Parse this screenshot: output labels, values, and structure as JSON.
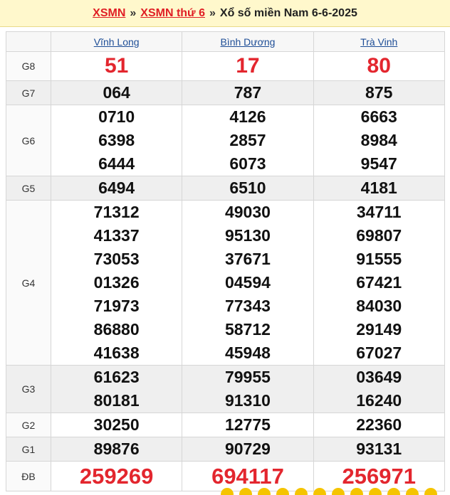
{
  "header": {
    "link1": "XSMN",
    "sep1": "»",
    "link2": "XSMN thứ 6",
    "sep2": "»",
    "title": "Xổ số miền Nam 6-6-2025"
  },
  "provinces": [
    "Vĩnh Long",
    "Bình Dương",
    "Trà Vinh"
  ],
  "prizes": {
    "g8": {
      "label": "G8",
      "values": [
        "51",
        "17",
        "80"
      ]
    },
    "g7": {
      "label": "G7",
      "values": [
        "064",
        "787",
        "875"
      ]
    },
    "g6": {
      "label": "G6",
      "values": [
        [
          "0710",
          "6398",
          "6444"
        ],
        [
          "4126",
          "2857",
          "6073"
        ],
        [
          "6663",
          "8984",
          "9547"
        ]
      ]
    },
    "g5": {
      "label": "G5",
      "values": [
        "6494",
        "6510",
        "4181"
      ]
    },
    "g4": {
      "label": "G4",
      "values": [
        [
          "71312",
          "41337",
          "73053",
          "01326",
          "71973",
          "86880",
          "41638"
        ],
        [
          "49030",
          "95130",
          "37671",
          "04594",
          "77343",
          "58712",
          "45948"
        ],
        [
          "34711",
          "69807",
          "91555",
          "67421",
          "84030",
          "29149",
          "67027"
        ]
      ]
    },
    "g3": {
      "label": "G3",
      "values": [
        [
          "61623",
          "80181"
        ],
        [
          "79955",
          "91310"
        ],
        [
          "03649",
          "16240"
        ]
      ]
    },
    "g2": {
      "label": "G2",
      "values": [
        "30250",
        "12775",
        "22360"
      ]
    },
    "g1": {
      "label": "G1",
      "values": [
        "89876",
        "90729",
        "93131"
      ]
    },
    "db": {
      "label": "ĐB",
      "values": [
        "259269",
        "694117",
        "256971"
      ]
    }
  },
  "colors": {
    "accent_red": "#e3262e",
    "header_bg": "#fff8cc",
    "link_blue": "#1d4d96"
  }
}
